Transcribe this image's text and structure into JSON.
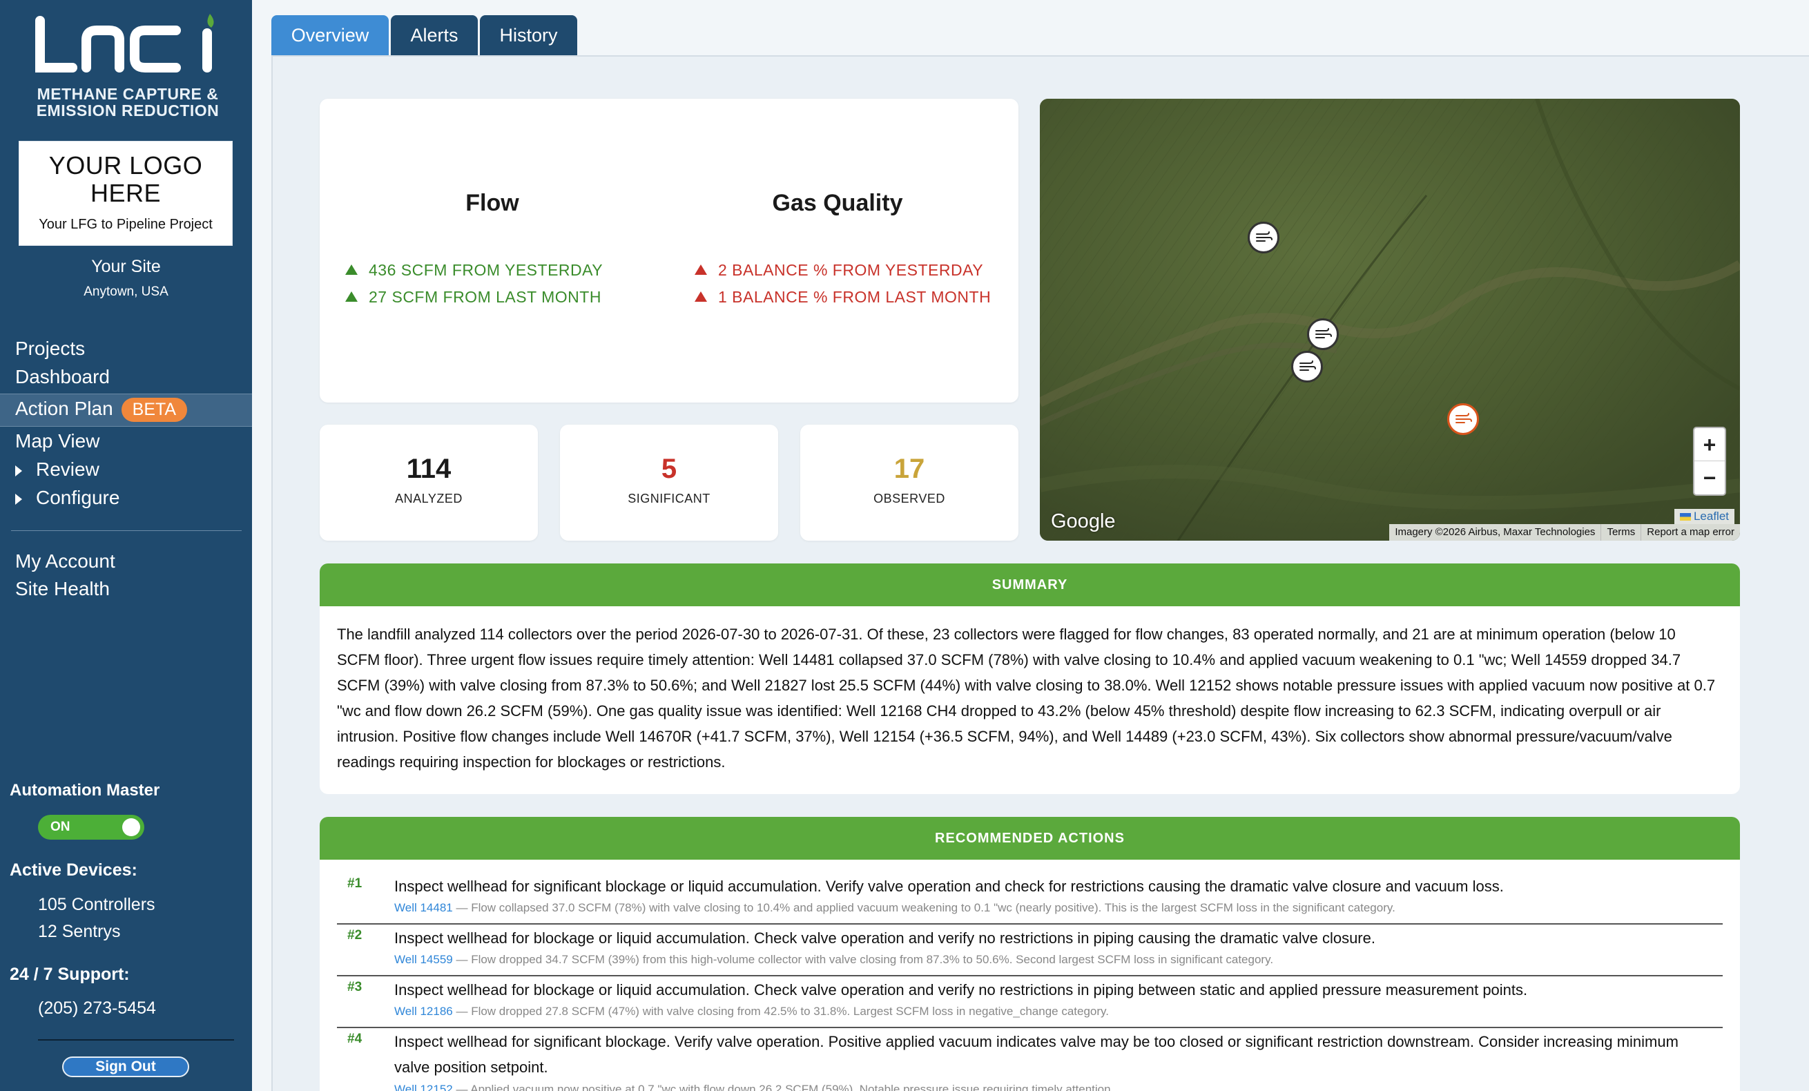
{
  "brand": {
    "logo_text": "LoCi",
    "tagline_1": "METHANE CAPTURE &",
    "tagline_2": "EMISSION REDUCTION"
  },
  "client_logo": {
    "title_1": "YOUR LOGO",
    "title_2": "HERE",
    "subtitle": "Your LFG to Pipeline Project"
  },
  "site": {
    "name": "Your Site",
    "location": "Anytown, USA"
  },
  "nav": {
    "projects": "Projects",
    "dashboard": "Dashboard",
    "action_plan": "Action Plan",
    "beta": "BETA",
    "map_view": "Map View",
    "review": "Review",
    "configure": "Configure",
    "my_account": "My Account",
    "site_health": "Site Health"
  },
  "automation": {
    "title": "Automation Master",
    "state": "ON"
  },
  "devices": {
    "title": "Active Devices:",
    "controllers": "105 Controllers",
    "sentrys": "12 Sentrys"
  },
  "support": {
    "title": "24 / 7 Support:",
    "phone": "(205) 273-5454"
  },
  "sign_out": "Sign Out",
  "tabs": {
    "overview": "Overview",
    "alerts": "Alerts",
    "history": "History"
  },
  "flow": {
    "title": "Flow",
    "day": "436 SCFM FROM YESTERDAY",
    "month": "27 SCFM FROM LAST MONTH"
  },
  "gas_quality": {
    "title": "Gas Quality",
    "day": "2 BALANCE % FROM YESTERDAY",
    "month": "1 BALANCE % FROM LAST MONTH"
  },
  "stats": {
    "analyzed": {
      "value": "114",
      "label": "ANALYZED"
    },
    "significant": {
      "value": "5",
      "label": "SIGNIFICANT"
    },
    "observed": {
      "value": "17",
      "label": "OBSERVED"
    }
  },
  "colors": {
    "positive": "#3a8c2b",
    "negative": "#c8322a",
    "observed": "#c9a43a",
    "accent": "#5ba93c",
    "sidebar": "#1f4a6e"
  },
  "map": {
    "google": "Google",
    "leaflet": "Leaflet",
    "imagery": "Imagery ©2026 Airbus, Maxar Technologies",
    "terms": "Terms",
    "report": "Report a map error",
    "zoom_in": "+",
    "zoom_out": "−"
  },
  "summary": {
    "title": "SUMMARY",
    "text": "The landfill analyzed 114 collectors over the period 2026-07-30 to 2026-07-31. Of these, 23 collectors were flagged for flow changes, 83 operated normally, and 21 are at minimum operation (below 10 SCFM floor). Three urgent flow issues require timely attention: Well 14481 collapsed 37.0 SCFM (78%) with valve closing to 10.4% and applied vacuum weakening to 0.1 \"wc; Well 14559 dropped 34.7 SCFM (39%) with valve closing from 87.3% to 50.6%; and Well 21827 lost 25.5 SCFM (44%) with valve closing to 38.0%. Well 12152 shows notable pressure issues with applied vacuum now positive at 0.7 \"wc and flow down 26.2 SCFM (59%). One gas quality issue was identified: Well 12168 CH4 dropped to 43.2% (below 45% threshold) despite flow increasing to 62.3 SCFM, indicating overpull or air intrusion. Positive flow changes include Well 14670R (+41.7 SCFM, 37%), Well 12154 (+36.5 SCFM, 94%), and Well 14489 (+23.0 SCFM, 43%). Six collectors show abnormal pressure/vacuum/valve readings requiring inspection for blockages or restrictions."
  },
  "actions": {
    "title": "RECOMMENDED ACTIONS",
    "items": [
      {
        "num": "#1",
        "text": "Inspect wellhead for significant blockage or liquid accumulation. Verify valve operation and check for restrictions causing the dramatic valve closure and vacuum loss.",
        "well": "Well 14481",
        "detail": " — Flow collapsed 37.0 SCFM (78%) with valve closing to 10.4% and applied vacuum weakening to 0.1 \"wc (nearly positive). This is the largest SCFM loss in the significant category."
      },
      {
        "num": "#2",
        "text": "Inspect wellhead for blockage or liquid accumulation. Check valve operation and verify no restrictions in piping causing the dramatic valve closure.",
        "well": "Well 14559",
        "detail": " — Flow dropped 34.7 SCFM (39%) from this high-volume collector with valve closing from 87.3% to 50.6%. Second largest SCFM loss in significant category."
      },
      {
        "num": "#3",
        "text": "Inspect wellhead for blockage or liquid accumulation. Check valve operation and verify no restrictions in piping between static and applied pressure measurement points.",
        "well": "Well 12186",
        "detail": " — Flow dropped 27.8 SCFM (47%) with valve closing from 42.5% to 31.8%. Largest SCFM loss in negative_change category."
      },
      {
        "num": "#4",
        "text": "Inspect wellhead for significant blockage. Verify valve operation. Positive applied vacuum indicates valve may be too closed or significant restriction downstream. Consider increasing minimum valve position setpoint.",
        "well": "Well 12152",
        "detail": " — Applied vacuum now positive at 0.7 \"wc with flow down 26.2 SCFM (59%). Notable pressure issue requiring timely attention."
      }
    ]
  }
}
